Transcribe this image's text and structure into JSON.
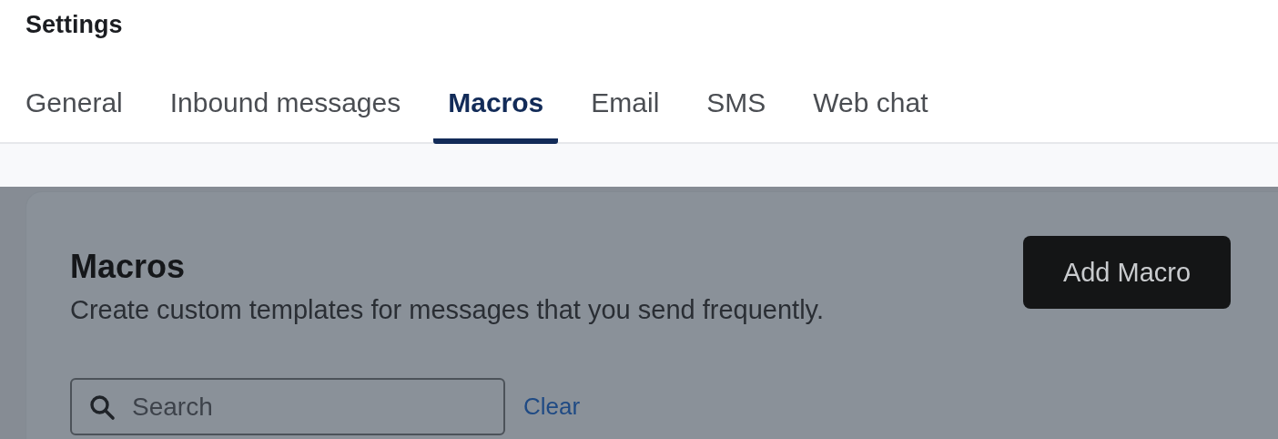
{
  "header": {
    "title": "Settings"
  },
  "tabs": [
    {
      "label": "General",
      "selected": false
    },
    {
      "label": "Inbound messages",
      "selected": false
    },
    {
      "label": "Macros",
      "selected": true
    },
    {
      "label": "Email",
      "selected": false
    },
    {
      "label": "SMS",
      "selected": false
    },
    {
      "label": "Web chat",
      "selected": false
    }
  ],
  "card": {
    "title": "Macros",
    "description": "Create custom templates for messages that you send frequently.",
    "button": "Add Macro"
  },
  "search": {
    "placeholder": "Search",
    "clear": "Clear"
  }
}
